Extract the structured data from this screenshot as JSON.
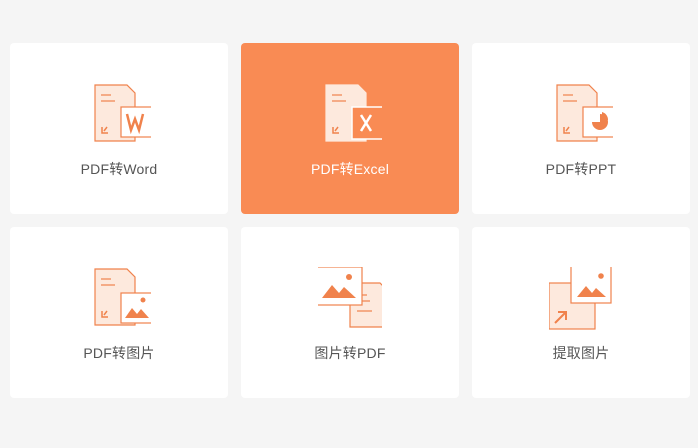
{
  "tools": [
    {
      "label": "PDF转Word",
      "icon": "pdf-to-word-icon",
      "active": false
    },
    {
      "label": "PDF转Excel",
      "icon": "pdf-to-excel-icon",
      "active": true
    },
    {
      "label": "PDF转PPT",
      "icon": "pdf-to-ppt-icon",
      "active": false
    },
    {
      "label": "PDF转图片",
      "icon": "pdf-to-image-icon",
      "active": false
    },
    {
      "label": "图片转PDF",
      "icon": "image-to-pdf-icon",
      "active": false
    },
    {
      "label": "提取图片",
      "icon": "extract-images-icon",
      "active": false
    }
  ],
  "colors": {
    "accent": "#f98b54",
    "icon_stroke": "#f0824c",
    "icon_fill_light": "#fde9dd",
    "card_bg": "#ffffff",
    "page_bg": "#f5f5f5",
    "label": "#555555",
    "active_label": "#ffffff"
  }
}
